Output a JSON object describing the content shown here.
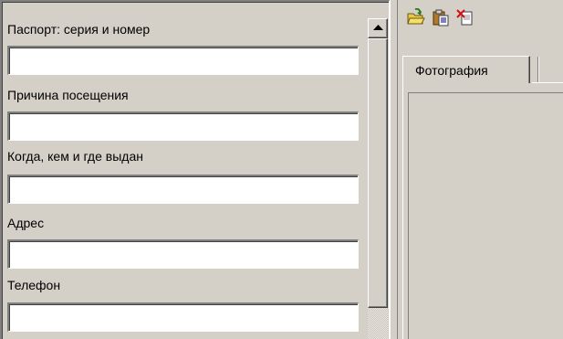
{
  "form": {
    "fields": [
      {
        "label": "Паспорт: серия и номер",
        "value": ""
      },
      {
        "label": "Причина посещения",
        "value": ""
      },
      {
        "label": "Когда, кем и где выдан",
        "value": ""
      },
      {
        "label": "Адрес",
        "value": ""
      },
      {
        "label": "Телефон",
        "value": ""
      }
    ]
  },
  "toolbar": {
    "buttons": [
      {
        "icon": "open-folder-icon"
      },
      {
        "icon": "paste-clipboard-icon"
      },
      {
        "icon": "delete-image-icon"
      }
    ]
  },
  "tabs": [
    {
      "label": "Фотография",
      "active": true
    }
  ],
  "colors": {
    "face": "#d4d0c8",
    "input_bg": "#ffffff",
    "shadow": "#808080"
  }
}
